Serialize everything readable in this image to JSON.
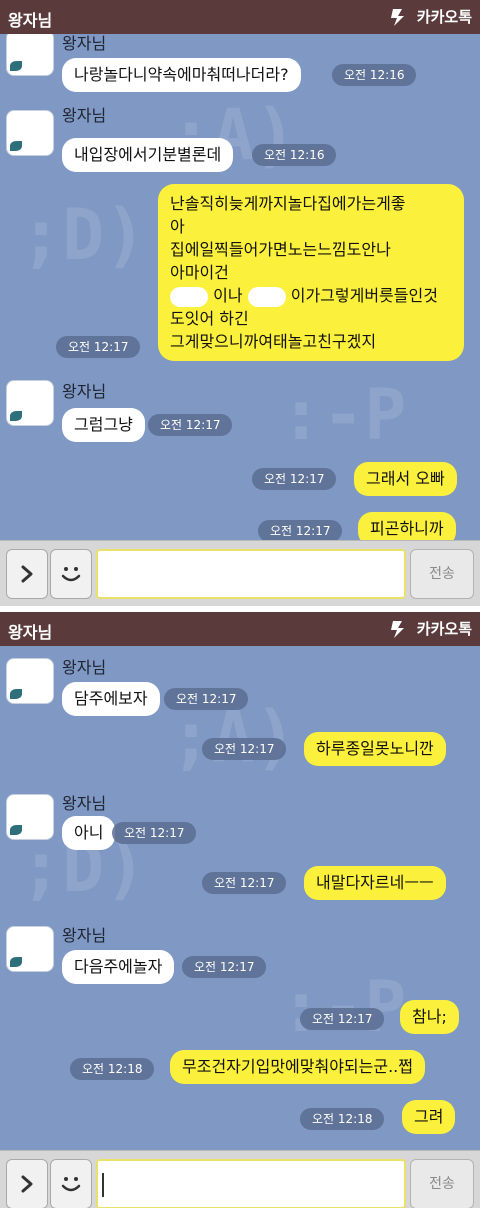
{
  "app": {
    "chat_title": "왕자님",
    "brand": "카카오톡"
  },
  "screens": [
    {
      "messages": [
        {
          "sender": "왕자님",
          "text": "나랑놀다니약속에마춰떠나더라?",
          "time": "오전 12:16"
        },
        {
          "sender": "왕자님",
          "text": "내입장에서기분별론데",
          "time": "오전 12:16"
        },
        {
          "lines": [
            "난솔직히늦게까지놀다집에가는게좋",
            "아",
            "집에일찍들어가면노는느낌도안나",
            "아마이건",
            "이나",
            "이가그렇게버릇들인것",
            "도잇어 하긴",
            "그게맞으니까여태놀고친구겠지"
          ],
          "time": "오전 12:17"
        },
        {
          "sender": "왕자님",
          "text": "그럼그냥",
          "time": "오전 12:17"
        },
        {
          "text": "그래서 오빠",
          "time": "오전 12:17"
        },
        {
          "text": "피곤하니까",
          "time": "오전 12:17"
        }
      ],
      "input": {
        "send_label": "전송",
        "value": ""
      }
    },
    {
      "messages": [
        {
          "sender": "왕자님",
          "text": "담주에보자",
          "time": "오전 12:17"
        },
        {
          "text": "하루종일못노니깐",
          "time": "오전 12:17"
        },
        {
          "sender": "왕자님",
          "text": "아니",
          "time": "오전 12:17"
        },
        {
          "text": "내말다자르네ㅡㅡ",
          "time": "오전 12:17"
        },
        {
          "sender": "왕자님",
          "text": "다음주에놀자",
          "time": "오전 12:17"
        },
        {
          "text": "참나;",
          "time": "오전 12:17"
        },
        {
          "text": "무조건자기입맛에맞춰야되는군..쩝",
          "time": "오전 12:18"
        },
        {
          "text": "그려",
          "time": "오전 12:18"
        }
      ],
      "input": {
        "send_label": "전송",
        "value": ""
      }
    }
  ],
  "colors": {
    "header": "#5a3a3a",
    "chat_bg": "#7f98c4",
    "my_bubble": "#fbf03b",
    "their_bubble": "#ffffff"
  },
  "icons": [
    "kakao-logo-icon",
    "chevron-right-icon",
    "smiley-icon"
  ]
}
